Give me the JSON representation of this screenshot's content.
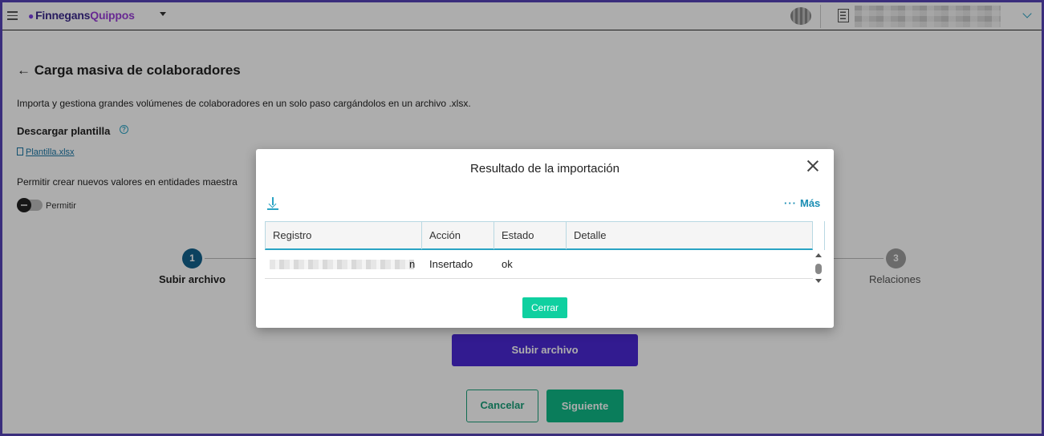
{
  "topbar": {
    "logo_part1": "Finnegans",
    "logo_part2": "Quippos"
  },
  "page": {
    "title": "Carga masiva de colaboradores",
    "description": "Importa y gestiona grandes volúmenes de colaboradores en un solo paso cargándolos en un archivo .xlsx.",
    "template_label": "Descargar plantilla",
    "template_link": "Plantilla.xlsx",
    "allow_text": "Permitir crear nuevos valores en entidades maestra",
    "toggle_label": "Permitir"
  },
  "stepper": {
    "step1_number": "1",
    "step1_label": "Subir archivo",
    "step3_number": "3",
    "step3_label": "Relaciones"
  },
  "actions": {
    "upload_label": "Subir archivo",
    "cancel_label": "Cancelar",
    "next_label": "Siguiente"
  },
  "modal": {
    "title": "Resultado de la importación",
    "more_label": "Más",
    "columns": [
      "Registro",
      "Acción",
      "Estado",
      "Detalle"
    ],
    "rows": [
      {
        "registro": "n",
        "accion": "Insertado",
        "estado": "ok",
        "detalle": ""
      }
    ],
    "close_label": "Cerrar"
  },
  "colors": {
    "primary": "#4a28d4",
    "accent": "#0fb886",
    "link": "#1a8db3"
  }
}
